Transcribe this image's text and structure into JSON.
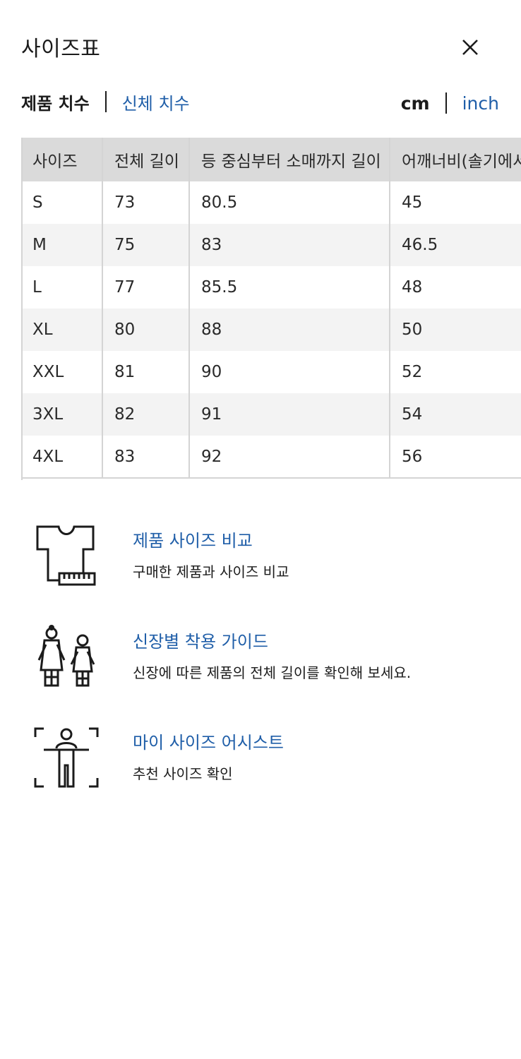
{
  "header": {
    "title": "사이즈표"
  },
  "tabs": {
    "product": "제품 치수",
    "body": "신체 치수"
  },
  "units": {
    "cm": "cm",
    "inch": "inch"
  },
  "table": {
    "headers": [
      "사이즈",
      "전체 길이",
      "등 중심부터 소매까지 길이",
      "어깨너비(솔기에서"
    ],
    "rows": [
      [
        "S",
        "73",
        "80.5",
        "45"
      ],
      [
        "M",
        "75",
        "83",
        "46.5"
      ],
      [
        "L",
        "77",
        "85.5",
        "48"
      ],
      [
        "XL",
        "80",
        "88",
        "50"
      ],
      [
        "XXL",
        "81",
        "90",
        "52"
      ],
      [
        "3XL",
        "82",
        "91",
        "54"
      ],
      [
        "4XL",
        "83",
        "92",
        "56"
      ]
    ]
  },
  "links": [
    {
      "title": "제품 사이즈 비교",
      "desc": "구매한 제품과 사이즈 비교",
      "icon": "shirt-ruler-icon"
    },
    {
      "title": "신장별 착용 가이드",
      "desc": "신장에 따른 제품의 전체 길이를 확인해 보세요.",
      "icon": "two-people-icon"
    },
    {
      "title": "마이 사이즈 어시스트",
      "desc": "추천 사이즈 확인",
      "icon": "body-scan-icon"
    }
  ],
  "colors": {
    "link": "#1f5ea8",
    "header_bg": "#dadada",
    "stripe": "#f3f3f3"
  }
}
